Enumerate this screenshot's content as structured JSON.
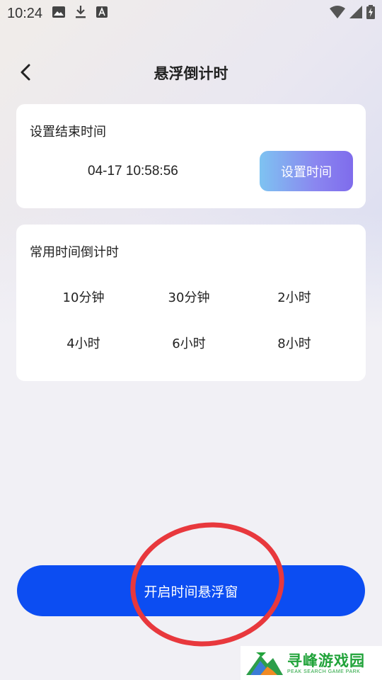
{
  "status_bar": {
    "time": "10:24",
    "left_icons": [
      "image-icon",
      "download-icon",
      "text-a-icon"
    ],
    "right_icons": [
      "wifi-icon",
      "signal-icon",
      "battery-charging-icon"
    ]
  },
  "header": {
    "title": "悬浮倒计时",
    "back_icon": "chevron-left-icon"
  },
  "end_time_card": {
    "title": "设置结束时间",
    "value": "04-17 10:58:56",
    "button_label": "设置时间"
  },
  "preset_card": {
    "title": "常用时间倒计时",
    "presets": [
      "10分钟",
      "30分钟",
      "2小时",
      "4小时",
      "6小时",
      "8小时"
    ]
  },
  "main_button": {
    "label": "开启时间悬浮窗"
  },
  "watermark": {
    "cn": "寻峰游戏园",
    "en": "PEAK SEARCH GAME PARK"
  },
  "colors": {
    "primary": "#0c4df2",
    "highlight_circle": "#e8383d",
    "gradient_start": "#7ec3f1",
    "gradient_end": "#7f6cec"
  }
}
